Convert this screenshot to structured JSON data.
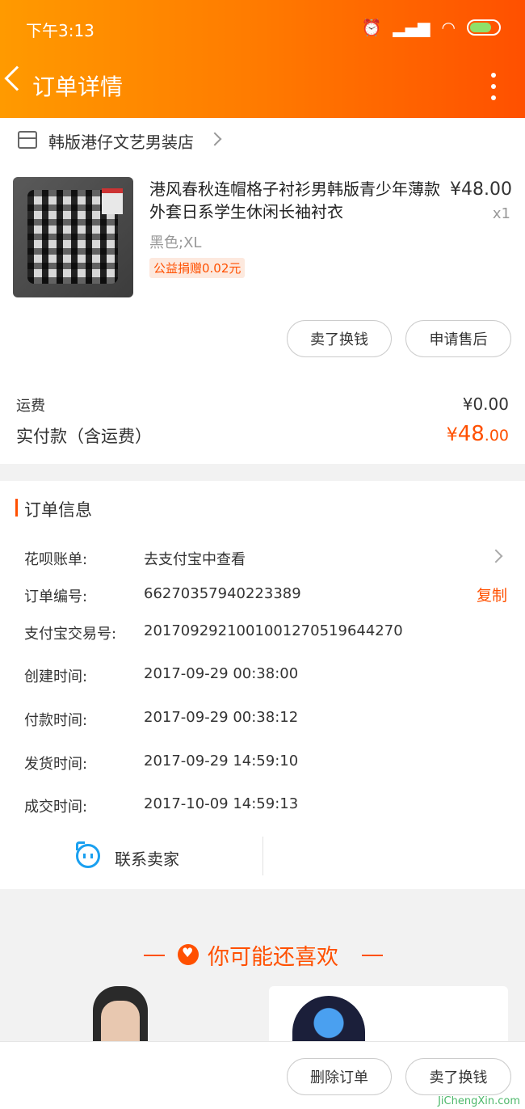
{
  "status_bar": {
    "time": "下午3:13"
  },
  "nav": {
    "title": "订单详情"
  },
  "store": {
    "name": "韩版港仔文艺男装店"
  },
  "product": {
    "title": "港风春秋连帽格子衬衫男韩版青少年薄款外套日系学生休闲长袖衬衣",
    "price": "¥48.00",
    "quantity": "x1",
    "sku": "黑色;XL",
    "charity_tag": "公益捐赠0.02元"
  },
  "actions": {
    "sell": "卖了换钱",
    "after_sale": "申请售后"
  },
  "fees": {
    "shipping_label": "运费",
    "shipping_value": "¥0.00",
    "total_label": "实付款（含运费）",
    "total_currency": "¥",
    "total_int": "48",
    "total_dec": ".00"
  },
  "order_info": {
    "title": "订单信息",
    "rows": [
      {
        "label": "花呗账单:",
        "value": "去支付宝中查看"
      },
      {
        "label": "订单编号:",
        "value": "66270357940223389"
      },
      {
        "label": "支付宝交易号:",
        "value": "2017092921001001270519644270"
      },
      {
        "label": "创建时间:",
        "value": "2017-09-29 00:38:00"
      },
      {
        "label": "付款时间:",
        "value": "2017-09-29 00:38:12"
      },
      {
        "label": "发货时间:",
        "value": "2017-09-29 14:59:10"
      },
      {
        "label": "成交时间:",
        "value": "2017-10-09 14:59:13"
      }
    ],
    "copy_label": "复制",
    "contact_label": "联系卖家"
  },
  "recommend": {
    "title": "你可能还喜欢"
  },
  "bottom_bar": {
    "delete_label": "删除订单",
    "sell_label": "卖了换钱"
  },
  "watermark": "JiChengXin.com"
}
